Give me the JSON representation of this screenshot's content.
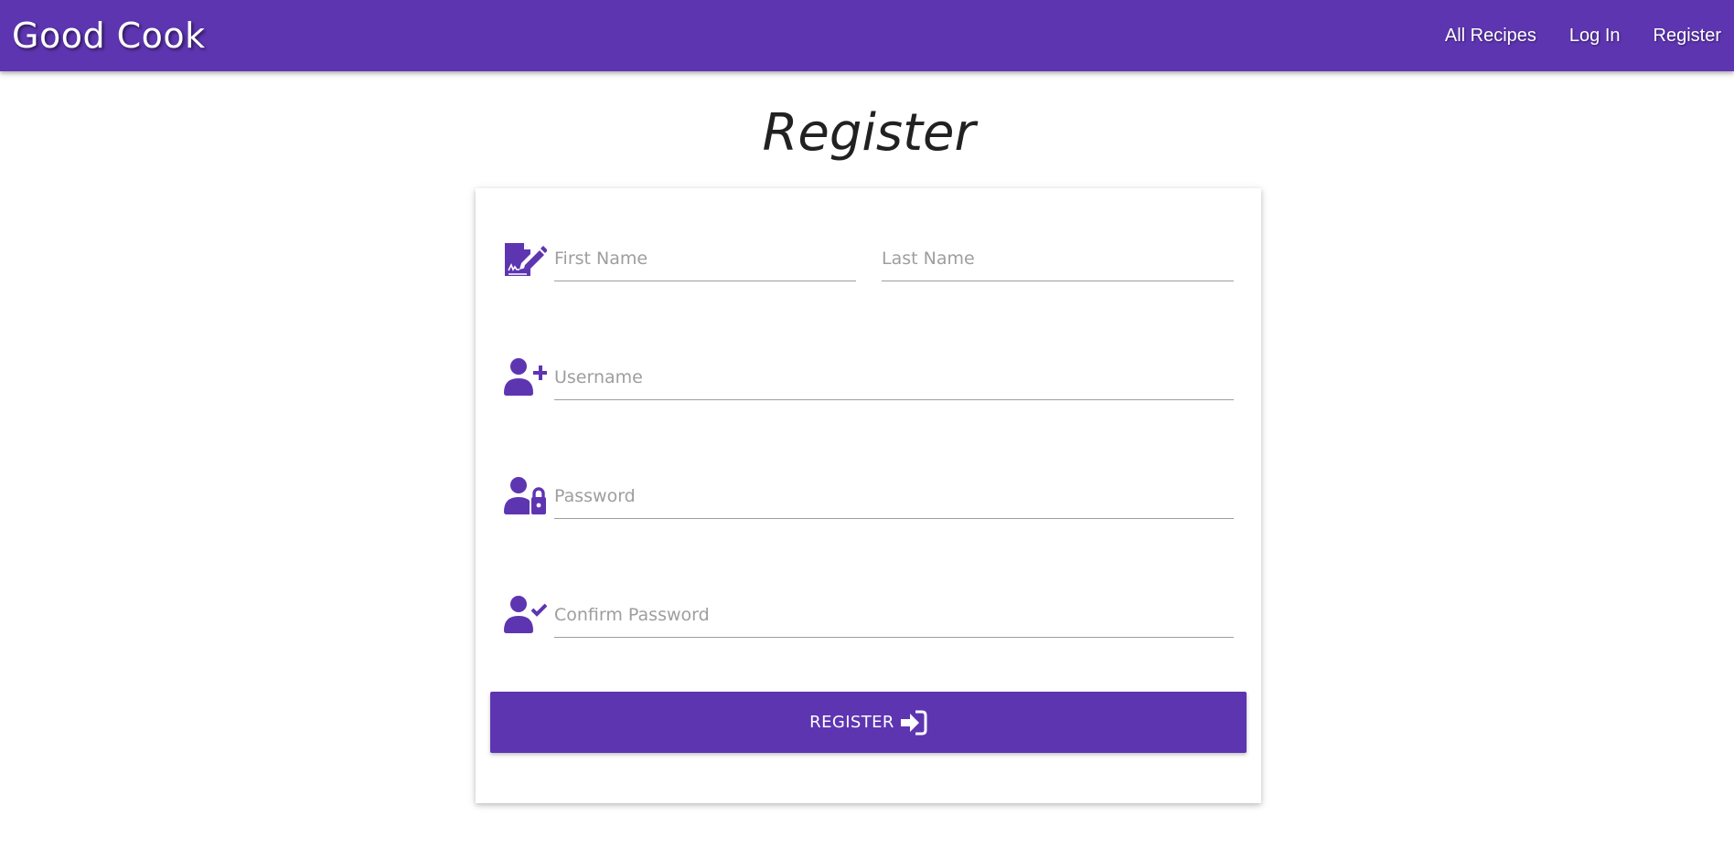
{
  "navbar": {
    "brand": "Good Cook",
    "links": [
      {
        "label": "All Recipes"
      },
      {
        "label": "Log In"
      },
      {
        "label": "Register"
      }
    ]
  },
  "page": {
    "title": "Register"
  },
  "form": {
    "first_name": {
      "placeholder": "First Name",
      "value": "",
      "icon": "file-signature-icon"
    },
    "last_name": {
      "placeholder": "Last Name",
      "value": ""
    },
    "username": {
      "placeholder": "Username",
      "value": "",
      "icon": "user-plus-icon"
    },
    "password": {
      "placeholder": "Password",
      "value": "",
      "icon": "user-lock-icon"
    },
    "confirm_password": {
      "placeholder": "Confirm Password",
      "value": "",
      "icon": "user-check-icon"
    },
    "submit_label": "REGISTER",
    "submit_icon": "sign-in-icon"
  },
  "colors": {
    "primary": "#5e35b1",
    "text": "#212121",
    "placeholder": "#9e9e9e",
    "underline": "#9e9e9e"
  }
}
